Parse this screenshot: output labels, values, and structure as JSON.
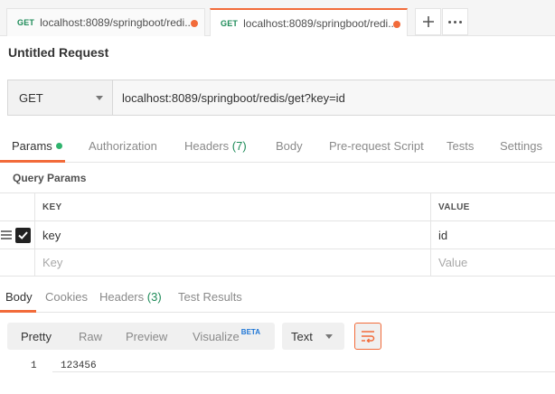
{
  "tabs": [
    {
      "method": "GET",
      "url": "localhost:8089/springboot/redi..."
    },
    {
      "method": "GET",
      "url": "localhost:8089/springboot/redi..."
    }
  ],
  "request": {
    "title": "Untitled Request",
    "method": "GET",
    "url": "localhost:8089/springboot/redis/get?key=id"
  },
  "request_tabs": {
    "params": "Params",
    "authorization": "Authorization",
    "headers": "Headers",
    "headers_count": "(7)",
    "body": "Body",
    "pre_request_script": "Pre-request Script",
    "tests": "Tests",
    "settings": "Settings"
  },
  "query_params": {
    "title": "Query Params",
    "key_header": "KEY",
    "value_header": "VALUE",
    "rows": [
      {
        "key": "key",
        "value": "id",
        "checked": true
      }
    ],
    "key_placeholder": "Key",
    "value_placeholder": "Value"
  },
  "response_tabs": {
    "body": "Body",
    "cookies": "Cookies",
    "headers": "Headers",
    "headers_count": "(3)",
    "test_results": "Test Results"
  },
  "body_toolbar": {
    "pretty": "Pretty",
    "raw": "Raw",
    "preview": "Preview",
    "visualize": "Visualize",
    "beta": "BETA",
    "format": "Text"
  },
  "response_body": {
    "line_number": "1",
    "content": "123456"
  },
  "colors": {
    "accent": "#f26b3a",
    "method_green": "#1d8b58",
    "beta_blue": "#1e76d6"
  }
}
